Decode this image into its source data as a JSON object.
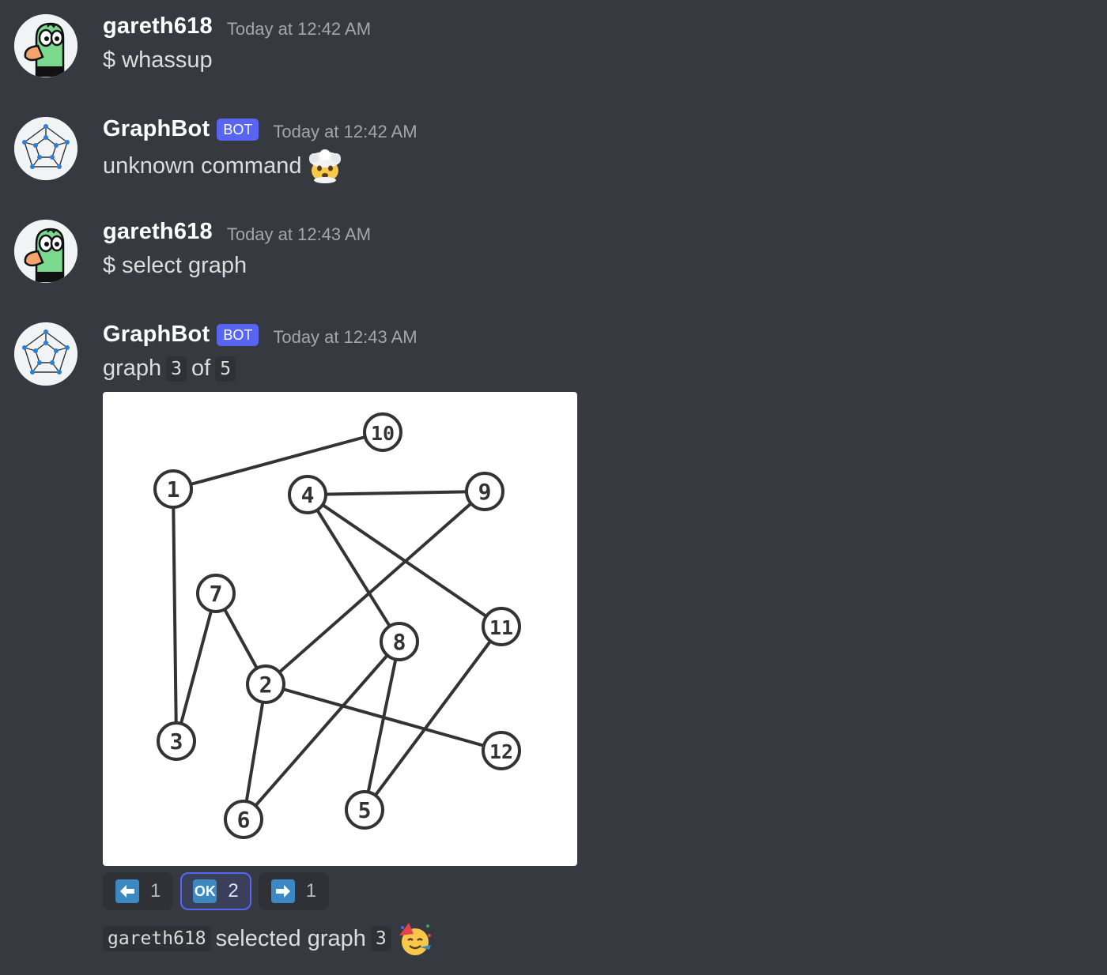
{
  "messages": [
    {
      "username": "gareth618",
      "timestamp": "Today at 12:42 AM",
      "text": "$ whassup",
      "avatar": "duck-avatar"
    },
    {
      "username": "GraphBot",
      "bot_tag": "BOT",
      "timestamp": "Today at 12:42 AM",
      "text": "unknown command",
      "emoji": "exploding-head-emoji",
      "avatar": "graph-avatar"
    },
    {
      "username": "gareth618",
      "timestamp": "Today at 12:43 AM",
      "text": "$ select graph",
      "avatar": "duck-avatar"
    },
    {
      "username": "GraphBot",
      "bot_tag": "BOT",
      "timestamp": "Today at 12:43 AM",
      "text_prefix": "graph",
      "current": "3",
      "text_mid": "of",
      "total": "5",
      "avatar": "graph-avatar",
      "reactions": [
        {
          "emoji": "left-arrow-emoji",
          "count": "1",
          "active": false
        },
        {
          "emoji": "ok-button-emoji",
          "label": "OK",
          "count": "2",
          "active": true
        },
        {
          "emoji": "right-arrow-emoji",
          "count": "1",
          "active": false
        }
      ],
      "followup": {
        "user": "gareth618",
        "text": "selected graph",
        "graph": "3",
        "emoji": "partying-face-emoji"
      }
    }
  ],
  "graph": {
    "nodes": [
      {
        "id": "1"
      },
      {
        "id": "2"
      },
      {
        "id": "3"
      },
      {
        "id": "4"
      },
      {
        "id": "5"
      },
      {
        "id": "6"
      },
      {
        "id": "7"
      },
      {
        "id": "8"
      },
      {
        "id": "9"
      },
      {
        "id": "10"
      },
      {
        "id": "11"
      },
      {
        "id": "12"
      }
    ],
    "edges": [
      [
        "1",
        "10"
      ],
      [
        "1",
        "3"
      ],
      [
        "4",
        "9"
      ],
      [
        "4",
        "8"
      ],
      [
        "4",
        "11"
      ],
      [
        "9",
        "2"
      ],
      [
        "7",
        "2"
      ],
      [
        "7",
        "3"
      ],
      [
        "2",
        "6"
      ],
      [
        "2",
        "12"
      ],
      [
        "8",
        "6"
      ],
      [
        "8",
        "5"
      ],
      [
        "11",
        "5"
      ]
    ]
  },
  "colors": {
    "background": "#36393f",
    "accent": "#5865f2",
    "code_bg": "#2f3136",
    "emoji_blue": "#3b88c3"
  }
}
